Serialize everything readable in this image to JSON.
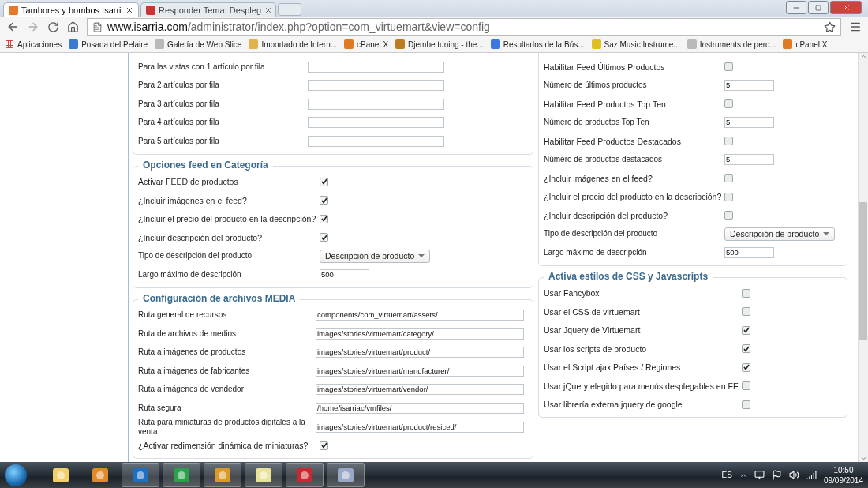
{
  "browser": {
    "tabs": [
      {
        "title": "Tambores y bombos Isarri",
        "selected": true
      },
      {
        "title": "Responder Tema: Despleg",
        "selected": false
      }
    ],
    "address": {
      "domain": "www.isarria.com",
      "path": "/administrator/index.php?option=com_virtuemart&view=config"
    },
    "bookmarks": [
      {
        "label": "Aplicaciones"
      },
      {
        "label": "Posada del Pelaire"
      },
      {
        "label": "Galería de Web Slice"
      },
      {
        "label": "Importado de Intern..."
      },
      {
        "label": "cPanel X"
      },
      {
        "label": "Djembe tuning - the..."
      },
      {
        "label": "Resultados de la Bús..."
      },
      {
        "label": "Saz Music Instrume..."
      },
      {
        "label": "Instruments de perc..."
      },
      {
        "label": "cPanel X"
      }
    ]
  },
  "left_sections": [
    {
      "rows": [
        {
          "kind": "text",
          "label": "Para las vistas con 1 artículo por fila"
        },
        {
          "kind": "text",
          "label": "Para 2 artículos por fila"
        },
        {
          "kind": "text",
          "label": "Para 3 artículos por fila"
        },
        {
          "kind": "text",
          "label": "Para 4 artículos por fila"
        },
        {
          "kind": "text",
          "label": "Para 5 artículos por fila"
        }
      ]
    },
    {
      "legend": "Opciones feed en Categoría",
      "rows": [
        {
          "kind": "checkbox",
          "label": "Activar FEED de productos",
          "checked": true
        },
        {
          "kind": "checkbox",
          "label": "¿Incluir imágenes en el feed?",
          "checked": true
        },
        {
          "kind": "checkbox",
          "label": "¿Incluir el precio del producto en la descripción?",
          "checked": true
        },
        {
          "kind": "checkbox",
          "label": "¿Incluir descripción del producto?",
          "checked": true
        },
        {
          "kind": "select",
          "label": "Tipo de descripción del producto",
          "value": "Descripción de producto"
        },
        {
          "kind": "short",
          "label": "Largo máximo de descripción",
          "value": "500"
        }
      ]
    },
    {
      "legend": "Configuración de archivos MEDIA",
      "rows": [
        {
          "kind": "path",
          "label": "Ruta general de recursos",
          "value": "components/com_virtuemart/assets/"
        },
        {
          "kind": "path",
          "label": "Ruta de archivos de medios",
          "value": "images/stories/virtuemart/category/"
        },
        {
          "kind": "path",
          "label": "Ruta a imágenes de productos",
          "value": "images/stories/virtuemart/product/"
        },
        {
          "kind": "path",
          "label": "Ruta a imágenes de fabricantes",
          "value": "images/stories/virtuemart/manufacturer/"
        },
        {
          "kind": "path",
          "label": "Ruta a imágenes de vendedor",
          "value": "images/stories/virtuemart/vendor/"
        },
        {
          "kind": "path",
          "label": "Ruta segura",
          "value": "/home/isarriac/vmfiles/"
        },
        {
          "kind": "path",
          "label": "Ruta para miniaturas de productos digitales a la venta",
          "value": "images/stories/virtuemart/product/resiced/"
        },
        {
          "kind": "checkbox",
          "label": "¿Activar redimensión dinámica de miniaturas?",
          "checked": true
        }
      ]
    }
  ],
  "right_sections": [
    {
      "rows": [
        {
          "kind": "checkbox",
          "label": "Habilitar Feed Últimos Productos",
          "checked": false
        },
        {
          "kind": "short",
          "label": "Número de últimos productos",
          "value": "5"
        },
        {
          "kind": "checkbox",
          "label": "Habilitar Feed Productos Top Ten",
          "checked": false
        },
        {
          "kind": "short",
          "label": "Número de productos Top Ten",
          "value": "5"
        },
        {
          "kind": "checkbox",
          "label": "Habilitar Feed Productos Destacados",
          "checked": false
        },
        {
          "kind": "short",
          "label": "Número de productos destacados",
          "value": "5"
        },
        {
          "kind": "checkbox",
          "label": "¿Incluir imágenes en el feed?",
          "checked": false
        },
        {
          "kind": "checkbox",
          "label": "¿Incluir el precio del producto en la descripción?",
          "checked": false
        },
        {
          "kind": "checkbox",
          "label": "¿Incluir descripción del producto?",
          "checked": false
        },
        {
          "kind": "select",
          "label": "Tipo de descripción del producto",
          "value": "Descripción de producto"
        },
        {
          "kind": "short",
          "label": "Largo máximo de descripción",
          "value": "500"
        }
      ]
    },
    {
      "legend": "Activa estilos de CSS y Javascripts",
      "rows": [
        {
          "kind": "checkbox",
          "label": "Usar Fancybox",
          "checked": false
        },
        {
          "kind": "checkbox",
          "label": "Usar el CSS de virtuemart",
          "checked": false
        },
        {
          "kind": "checkbox",
          "label": "Usar Jquery de Virtuemart",
          "checked": true
        },
        {
          "kind": "checkbox",
          "label": "Usar los scripts de producto",
          "checked": true
        },
        {
          "kind": "checkbox",
          "label": "Usar el Script ajax Países / Regiones",
          "checked": true
        },
        {
          "kind": "checkbox",
          "label": "Usar jQuery elegido para menús desplegables en FE",
          "checked": false
        },
        {
          "kind": "checkbox",
          "label": "Usar librería externa jquery de google",
          "checked": false
        }
      ]
    }
  ],
  "taskbar": {
    "language": "ES",
    "time": "10:50",
    "date": "09/09/2014"
  }
}
